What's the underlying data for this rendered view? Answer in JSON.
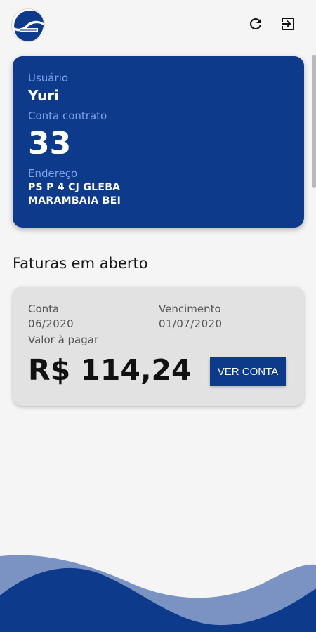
{
  "header": {
    "logo_icon": "company-logo",
    "refresh_icon": "refresh-icon",
    "logout_icon": "logout-icon"
  },
  "user_card": {
    "user_label": "Usuário",
    "user_name": "Yuri",
    "contract_label": "Conta contrato",
    "contract_number": "33",
    "address_label": "Endereço",
    "address_line1": "PS P 4 CJ GLEBA",
    "address_line2": "MARAMBAIA BEI"
  },
  "open_invoices": {
    "title": "Faturas em aberto",
    "items": [
      {
        "account_label": "Conta",
        "account_value": "06/2020",
        "due_label": "Vencimento",
        "due_value": "01/07/2020",
        "amount_label": "Valor à pagar",
        "amount": "R$ 114,24",
        "button_label": "VER CONTA"
      }
    ]
  },
  "colors": {
    "primary": "#0e3a8c",
    "primary_label": "#7ea3e6",
    "background": "#f5f5f5",
    "card": "#e2e2e2",
    "wave_light": "#7a93c2"
  }
}
